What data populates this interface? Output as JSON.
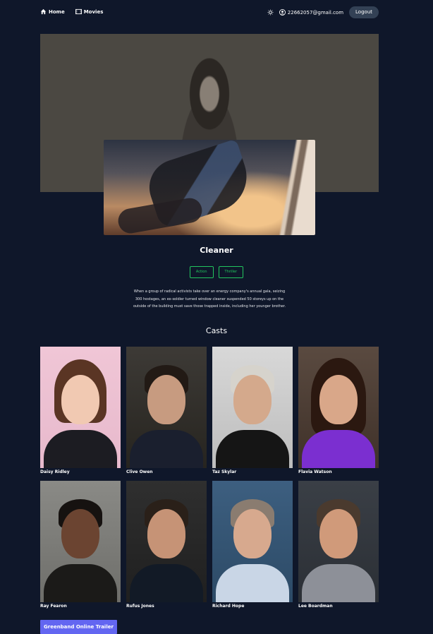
{
  "nav": {
    "home_label": "Home",
    "movies_label": "Movies",
    "user_email": "22662057@gmail.com",
    "logout_label": "Logout"
  },
  "movie": {
    "title": "Cleaner",
    "genres": [
      "Action",
      "Thriller"
    ],
    "overview": "When a group of radical activists take over an energy company's annual gala, seizing 300 hostages, an ex-soldier turned window cleaner suspended 50 storeys up on the outside of the building must save those trapped inside, including her younger brother."
  },
  "casts_heading": "Casts",
  "casts": [
    {
      "name": "Daisy Ridley"
    },
    {
      "name": "Clive Owen"
    },
    {
      "name": "Taz Skylar"
    },
    {
      "name": "Flavia Watson"
    },
    {
      "name": "Ray Fearon"
    },
    {
      "name": "Rufus Jones"
    },
    {
      "name": "Richard Hope"
    },
    {
      "name": "Lee Boardman"
    }
  ],
  "trailer_button_label": "Greenband Online Trailer",
  "colors": {
    "background": "#0f172a",
    "genre_accent": "#22c55e",
    "trailer_button": "#6366f1",
    "logout_button": "#334155"
  }
}
